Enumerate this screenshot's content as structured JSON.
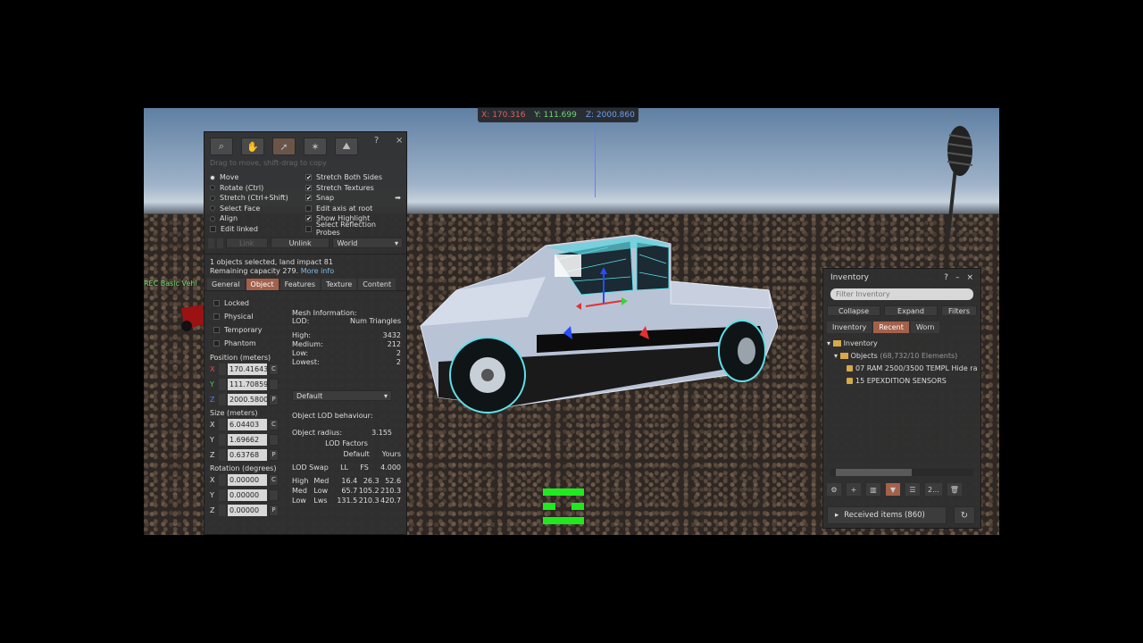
{
  "coords": {
    "x": "X: 170.316",
    "y": "Y: 111.699",
    "z": "Z: 2000.860"
  },
  "side_label": "REC Basic Vehi",
  "build": {
    "hint": "Drag to move, shift-drag to copy",
    "help": "?",
    "close": "×",
    "modes": [
      "Move",
      "Rotate (Ctrl)",
      "Stretch (Ctrl+Shift)",
      "Select Face",
      "Align",
      "Edit linked"
    ],
    "checks": [
      "Stretch Both Sides",
      "Stretch Textures",
      "Snap",
      "Edit axis at root",
      "Show Highlight",
      "Select Reflection Probes"
    ],
    "link_btn": "Link",
    "unlink_btn": "Unlink",
    "world_select": "World",
    "selection_line": "1 objects selected, land impact 81",
    "capacity_line": "Remaining capacity 279.",
    "more_info": "More info",
    "tabs": [
      "General",
      "Object",
      "Features",
      "Texture",
      "Content"
    ],
    "flags": [
      "Locked",
      "Physical",
      "Temporary",
      "Phantom"
    ],
    "position_label": "Position (meters)",
    "position": {
      "x": "170.41643",
      "y": "111.70859",
      "z": "2000.5800"
    },
    "size_label": "Size (meters)",
    "size": {
      "x": "6.04403",
      "y": "1.69662",
      "z": "0.63768"
    },
    "rotation_label": "Rotation (degrees)",
    "rotation": {
      "x": "0.00000",
      "y": "0.00000",
      "z": "0.00000"
    },
    "axes": {
      "x": "X",
      "y": "Y",
      "z": "Z"
    },
    "btn_c": "C",
    "btn_p": "P",
    "mesh_info": "Mesh Information:",
    "lod": "LOD:",
    "num_tri": "Num Triangles",
    "mesh_rows": [
      {
        "k": "High:",
        "v": "3432"
      },
      {
        "k": "Medium:",
        "v": "212"
      },
      {
        "k": "Low:",
        "v": "2"
      },
      {
        "k": "Lowest:",
        "v": "2"
      }
    ],
    "default_select": "Default",
    "lod_behaviour": "Object LOD behaviour:",
    "radius_label": "Object radius:",
    "radius": "3.155",
    "lod_factors": "LOD Factors",
    "default_col": "Default",
    "yours_col": "Yours",
    "lod_swap": "LOD Swap",
    "ll": "LL",
    "fs": "FS",
    "fs_val": "4.000",
    "swap_rows": [
      {
        "a": "High",
        "b": "Med",
        "c": "16.4",
        "d": "26.3",
        "e": "52.6"
      },
      {
        "a": "Med",
        "b": "Low",
        "c": "65.7",
        "d": "105.2",
        "e": "210.3"
      },
      {
        "a": "Low",
        "b": "Lws",
        "c": "131.5",
        "d": "210.3",
        "e": "420.7"
      }
    ]
  },
  "inventory": {
    "title": "Inventory",
    "help": "?",
    "minimize": "–",
    "close": "×",
    "filter_placeholder": "Filter Inventory",
    "collapse": "Collapse",
    "expand": "Expand",
    "filters": "Filters",
    "tabs": [
      "Inventory",
      "Recent",
      "Worn"
    ],
    "tree": {
      "root": "Inventory",
      "folder": "Objects",
      "folder_count": "(68,732/10 Elements)",
      "items": [
        "07 RAM 2500/3500 TEMPL Hide ra",
        "15 EPEXDITION SENSORS"
      ]
    },
    "bottom_more": "2...",
    "received": "Received items (860)"
  }
}
